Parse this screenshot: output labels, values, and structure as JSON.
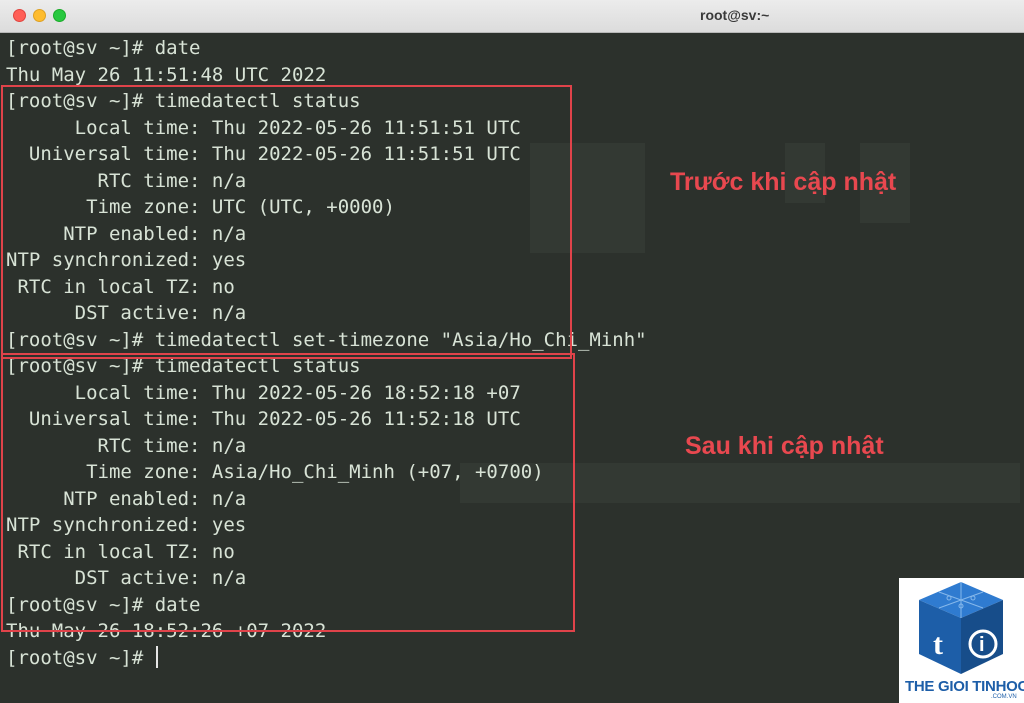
{
  "window": {
    "title": "root@sv:~"
  },
  "terminal": {
    "lines": [
      "[root@sv ~]# date",
      "Thu May 26 11:51:48 UTC 2022",
      "[root@sv ~]# timedatectl status",
      "      Local time: Thu 2022-05-26 11:51:51 UTC",
      "  Universal time: Thu 2022-05-26 11:51:51 UTC",
      "        RTC time: n/a",
      "       Time zone: UTC (UTC, +0000)",
      "     NTP enabled: n/a",
      "NTP synchronized: yes",
      " RTC in local TZ: no",
      "      DST active: n/a",
      "[root@sv ~]# timedatectl set-timezone \"Asia/Ho_Chi_Minh\"",
      "[root@sv ~]# timedatectl status",
      "      Local time: Thu 2022-05-26 18:52:18 +07",
      "  Universal time: Thu 2022-05-26 11:52:18 UTC",
      "        RTC time: n/a",
      "       Time zone: Asia/Ho_Chi_Minh (+07, +0700)",
      "     NTP enabled: n/a",
      "NTP synchronized: yes",
      " RTC in local TZ: no",
      "      DST active: n/a",
      "[root@sv ~]# date",
      "Thu May 26 18:52:26 +07 2022",
      "[root@sv ~]# "
    ]
  },
  "annotations": {
    "before_label": "Trước khi cập nhật",
    "after_label": "Sau khi cập nhật"
  },
  "watermark": {
    "brand": "THE GIOI TINHOC",
    "domain": ".COM.VN"
  },
  "colors": {
    "highlight": "#e0434a",
    "terminal_bg": "#2c312c",
    "terminal_text": "#d8e3d6",
    "brand": "#1d5ea8"
  }
}
